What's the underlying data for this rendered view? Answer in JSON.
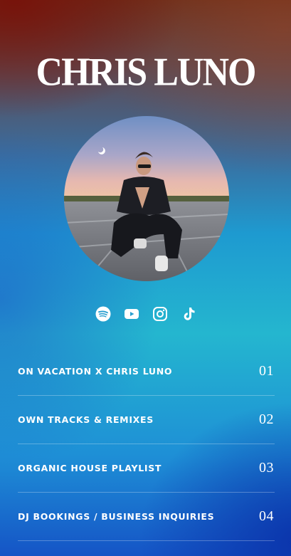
{
  "profile": {
    "name": "CHRIS LUNO"
  },
  "socials": [
    {
      "icon": "spotify-icon"
    },
    {
      "icon": "youtube-icon"
    },
    {
      "icon": "instagram-icon"
    },
    {
      "icon": "tiktok-icon"
    }
  ],
  "links": [
    {
      "label": "ON VACATION X CHRIS LUNO",
      "number": "01"
    },
    {
      "label": "OWN TRACKS & REMIXES",
      "number": "02"
    },
    {
      "label": "ORGANIC HOUSE PLAYLIST",
      "number": "03"
    },
    {
      "label": "DJ BOOKINGS / BUSINESS INQUIRIES",
      "number": "04"
    }
  ],
  "colors": {
    "text": "#ffffff",
    "top_gradient": "#6a2f1c",
    "middle_gradient": "#24b6cf",
    "bottom_gradient": "#1554c6"
  }
}
